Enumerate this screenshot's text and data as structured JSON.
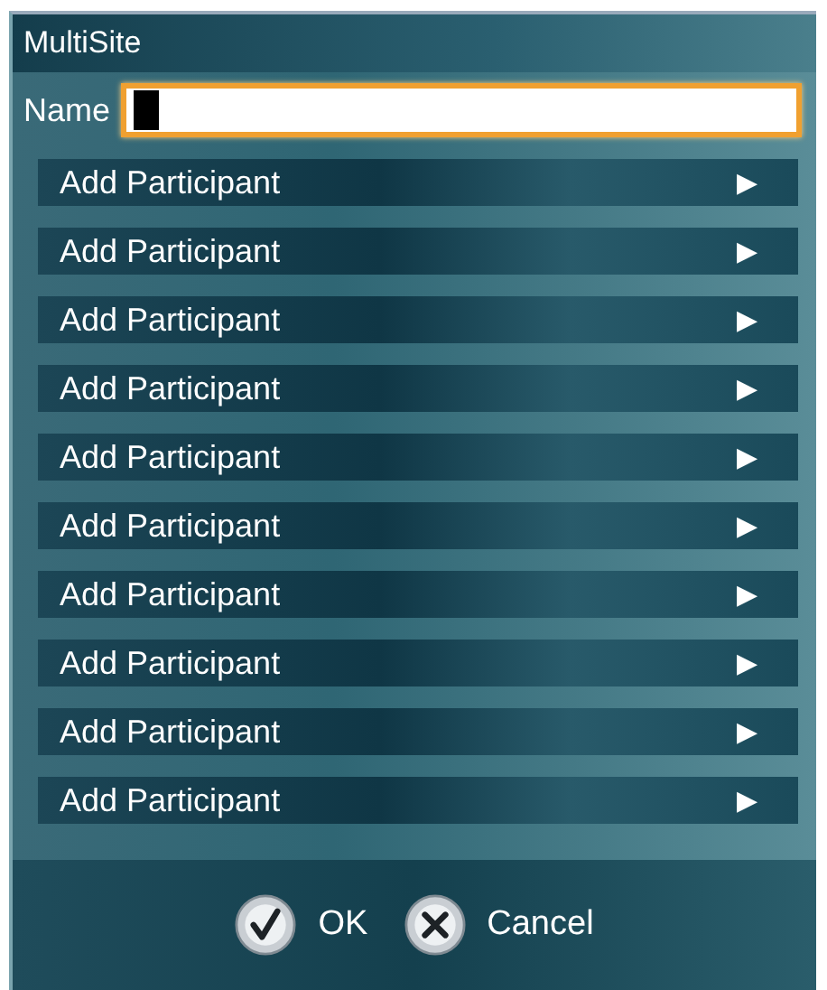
{
  "window": {
    "title": "MultiSite"
  },
  "name_field": {
    "label": "Name",
    "focused": true
  },
  "participants": [
    {
      "label": "Add Participant",
      "arrow": "▶"
    },
    {
      "label": "Add Participant",
      "arrow": "▶"
    },
    {
      "label": "Add Participant",
      "arrow": "▶"
    },
    {
      "label": "Add Participant",
      "arrow": "▶"
    },
    {
      "label": "Add Participant",
      "arrow": "▶"
    },
    {
      "label": "Add Participant",
      "arrow": "▶"
    },
    {
      "label": "Add Participant",
      "arrow": "▶"
    },
    {
      "label": "Add Participant",
      "arrow": "▶"
    },
    {
      "label": "Add Participant",
      "arrow": "▶"
    },
    {
      "label": "Add Participant",
      "arrow": "▶"
    }
  ],
  "buttons": [
    {
      "kind": "ok",
      "label": "OK"
    },
    {
      "kind": "cancel",
      "label": "Cancel"
    }
  ]
}
